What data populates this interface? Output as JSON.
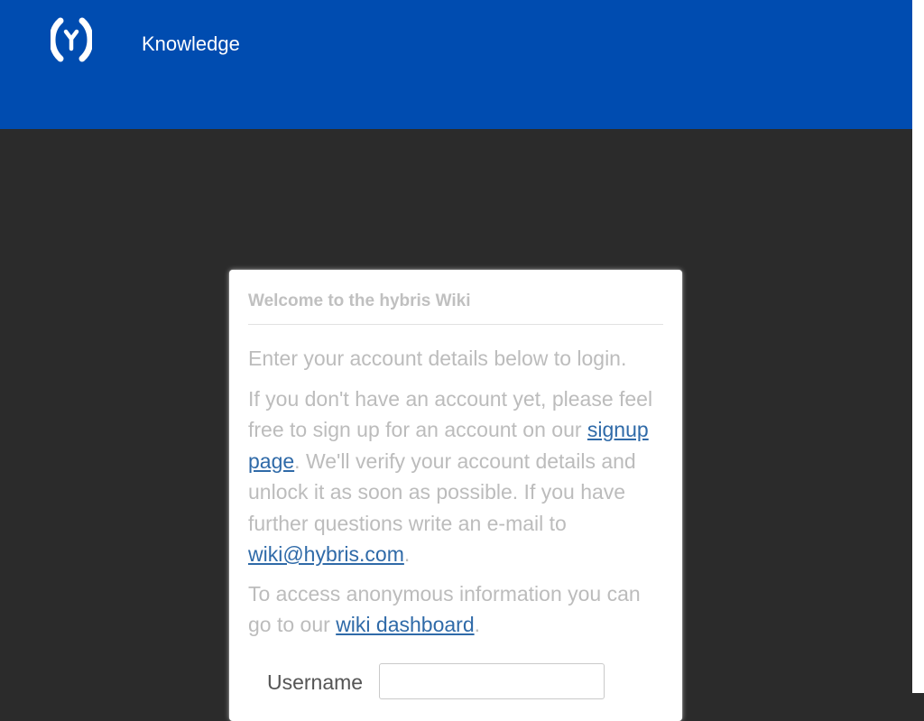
{
  "header": {
    "brand_title": "Knowledge",
    "background_color": "#004cb0",
    "logo_icon": "hybris-logo-icon"
  },
  "login": {
    "title": "Welcome to the hybris Wiki",
    "intro": "Enter your account details below to login.",
    "signup_text_before": "If you don't have an account yet, please feel free to sign up for an account on our ",
    "signup_link": "signup page",
    "signup_text_after": ". We'll verify your account details and unlock it as soon as possible. If you have further questions write an e-mail to ",
    "email_link": "wiki@hybris.com",
    "email_text_after": ".",
    "anon_text_before": "To access anonymous information you can go to our ",
    "dashboard_link": "wiki dashboard",
    "anon_text_after": ".",
    "username_label": "Username",
    "username_value": "",
    "link_color": "#2f6aa8"
  }
}
